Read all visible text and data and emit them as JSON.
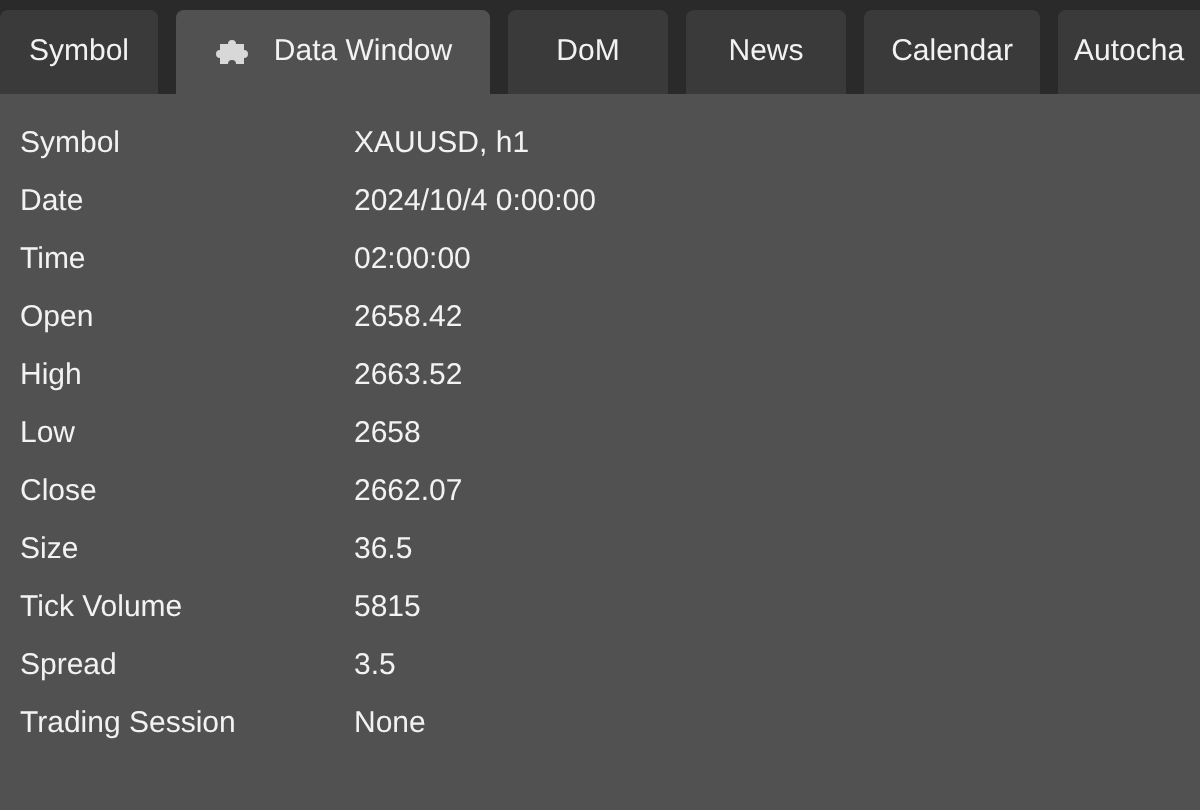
{
  "tabs": [
    {
      "label": "Symbol",
      "selected": false,
      "icon": false
    },
    {
      "label": "Data Window",
      "selected": true,
      "icon": true
    },
    {
      "label": "DoM",
      "selected": false,
      "icon": false
    },
    {
      "label": "News",
      "selected": false,
      "icon": false
    },
    {
      "label": "Calendar",
      "selected": false,
      "icon": false
    },
    {
      "label": "Autocha",
      "selected": false,
      "icon": false
    }
  ],
  "rows": [
    {
      "label": "Symbol",
      "value": "XAUUSD, h1"
    },
    {
      "label": "Date",
      "value": "2024/10/4 0:00:00"
    },
    {
      "label": "Time",
      "value": "02:00:00"
    },
    {
      "label": "Open",
      "value": "2658.42"
    },
    {
      "label": "High",
      "value": "2663.52"
    },
    {
      "label": "Low",
      "value": "2658"
    },
    {
      "label": "Close",
      "value": "2662.07"
    },
    {
      "label": "Size",
      "value": "36.5"
    },
    {
      "label": "Tick Volume",
      "value": "5815"
    },
    {
      "label": "Spread",
      "value": "3.5"
    },
    {
      "label": "Trading Session",
      "value": "None"
    }
  ]
}
